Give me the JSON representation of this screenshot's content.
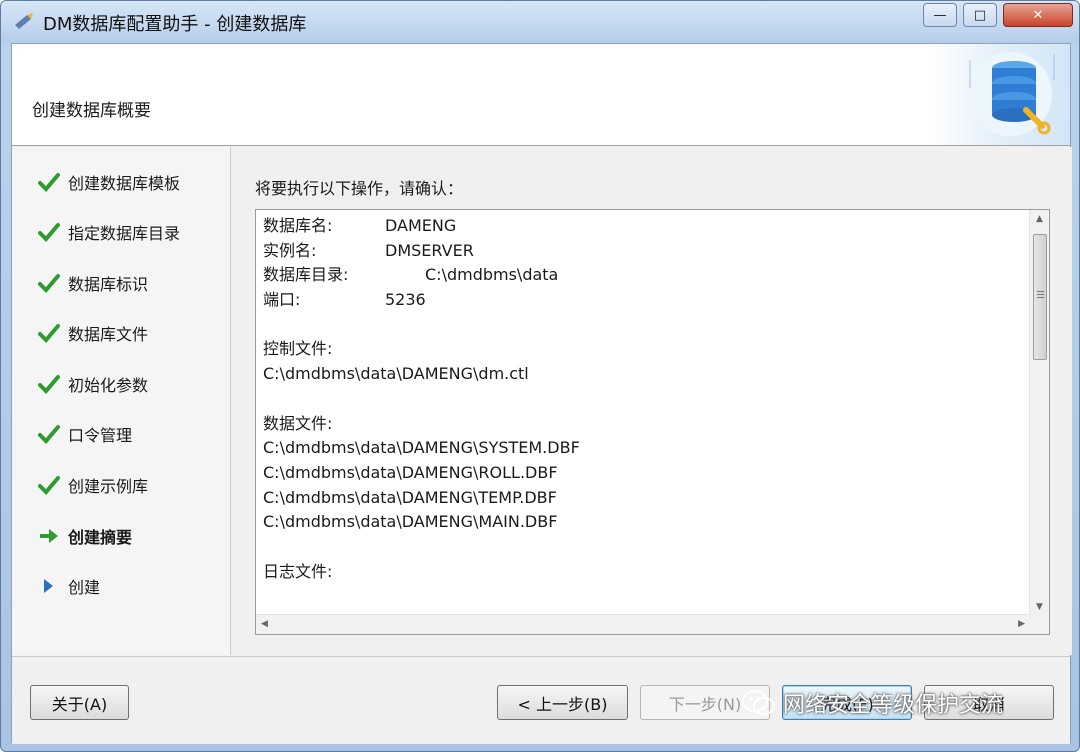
{
  "window": {
    "title": "DM数据库配置助手 - 创建数据库",
    "controls": {
      "minimize": "—",
      "maximize": "□",
      "close": "✕"
    }
  },
  "header": {
    "title": "创建数据库概要",
    "art_icon": "database-config-icon"
  },
  "steps": [
    {
      "label": "创建数据库模板",
      "state": "done"
    },
    {
      "label": "指定数据库目录",
      "state": "done"
    },
    {
      "label": "数据库标识",
      "state": "done"
    },
    {
      "label": "数据库文件",
      "state": "done"
    },
    {
      "label": "初始化参数",
      "state": "done"
    },
    {
      "label": "口令管理",
      "state": "done"
    },
    {
      "label": "创建示例库",
      "state": "done"
    },
    {
      "label": "创建摘要",
      "state": "current"
    },
    {
      "label": "创建",
      "state": "pending"
    }
  ],
  "main": {
    "prompt": "将要执行以下操作，请确认：",
    "summary": {
      "db_name_key": "数据库名:",
      "db_name_val": "DAMENG",
      "instance_key": "实例名:",
      "instance_val": "DMSERVER",
      "dir_key": "数据库目录:",
      "dir_val": "C:\\dmdbms\\data",
      "port_key": "端口:",
      "port_val": "5236",
      "ctl_header": "控制文件:",
      "ctl_file": "C:\\dmdbms\\data\\DAMENG\\dm.ctl",
      "data_header": "数据文件:",
      "data_files": [
        "C:\\dmdbms\\data\\DAMENG\\SYSTEM.DBF",
        "C:\\dmdbms\\data\\DAMENG\\ROLL.DBF",
        "C:\\dmdbms\\data\\DAMENG\\TEMP.DBF",
        "C:\\dmdbms\\data\\DAMENG\\MAIN.DBF"
      ],
      "log_header": "日志文件:"
    }
  },
  "footer": {
    "about": "关于(A)",
    "back": "< 上一步(B)",
    "next": "下一步(N)",
    "finish": "完成(F)",
    "cancel": "取消"
  },
  "watermark": {
    "text": "网络安全等级保护交流"
  },
  "colors": {
    "check": "#2e9b2e",
    "current_arrow": "#2e9b2e",
    "pending_arrow": "#2a6fc0"
  }
}
